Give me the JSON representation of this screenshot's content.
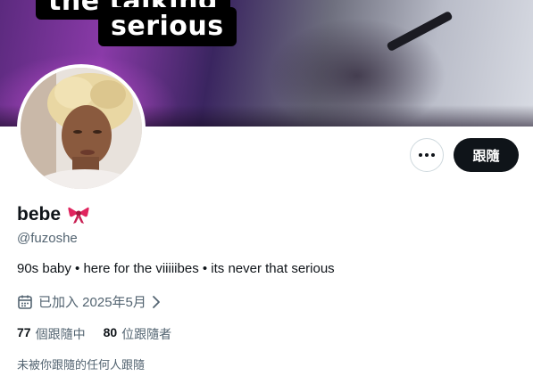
{
  "banner": {
    "caption_line1": "the talking",
    "caption_line2": "serious"
  },
  "actions": {
    "more_icon": "more-horizontal-icon",
    "follow_label": "跟隨"
  },
  "profile": {
    "display_name": "bebe",
    "name_emoji": "ribbon-bow-icon",
    "handle": "@fuzoshe",
    "bio": "90s baby • here for the viiiiibes • its never that serious",
    "joined_icon": "calendar-icon",
    "joined_text": "已加入 2025年5月",
    "following_count": "77",
    "following_label": "個跟隨中",
    "followers_count": "80",
    "followers_label": "位跟隨者",
    "followed_by_note": "未被你跟隨的任何人跟隨"
  },
  "colors": {
    "text_primary": "#0f1419",
    "text_secondary": "#536471",
    "follow_button_bg": "#0f1419",
    "ribbon": "#e0245e"
  }
}
